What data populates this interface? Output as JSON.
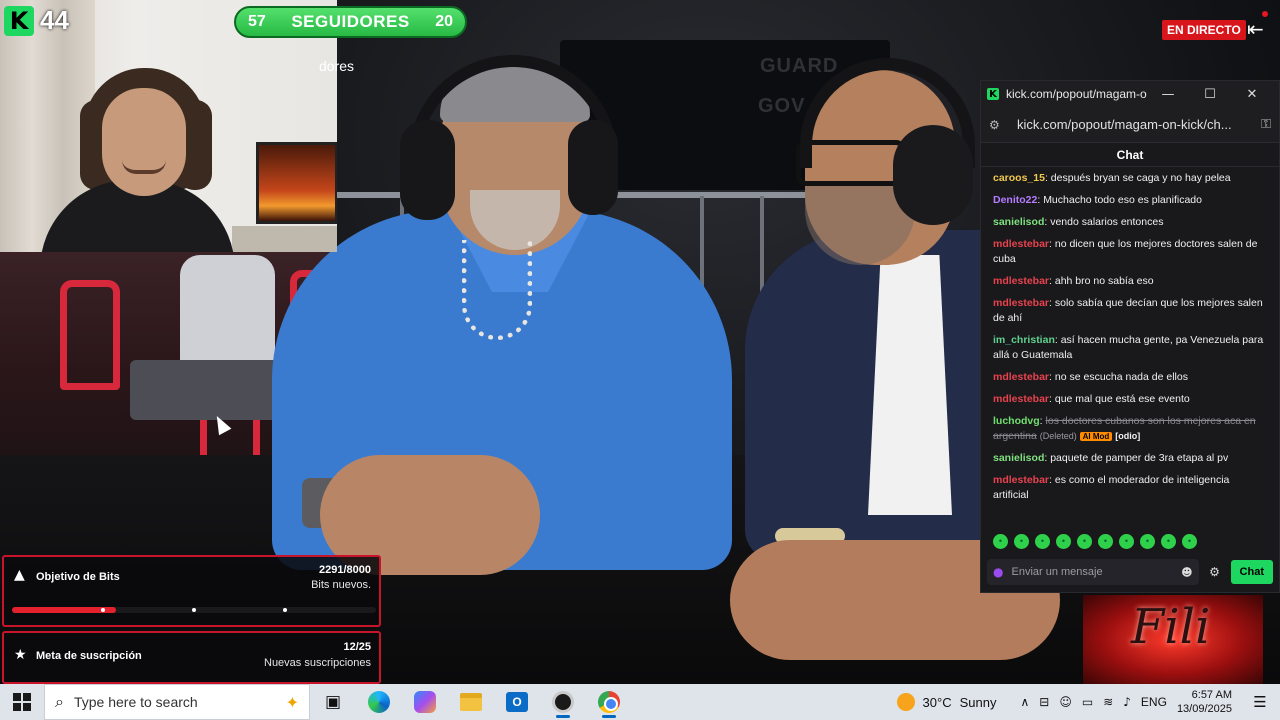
{
  "overlay": {
    "viewer_count": "44",
    "kick_icon_letter": "K",
    "followers_current": "57",
    "followers_label": "SEGUIDORES",
    "followers_goal": "20",
    "background_partial_text": "dores",
    "live_badge": "EN DIRECTO",
    "exit_icon": "exit-icon",
    "banner_text_1": "GUARD",
    "banner_text_2": "GOV",
    "bits_goal": {
      "title": "Objetivo de Bits",
      "value": "2291/8000",
      "subtitle": "Bits nuevos.",
      "progress": 0.286,
      "milestones": [
        0.25,
        0.5,
        0.75
      ]
    },
    "subs_goal": {
      "title": "Meta de suscripción",
      "value": "12/25",
      "subtitle": "Nuevas suscripciones"
    },
    "fili_text": "Fili"
  },
  "chat_window": {
    "title": "kick.com/popout/magam-o...",
    "url": "kick.com/popout/magam-on-kick/ch...",
    "header": "Chat",
    "messages": [
      {
        "user": "caroos_15",
        "color": "#f2c94c",
        "text": "después bryan se caga y no hay pelea"
      },
      {
        "user": "Denito22",
        "color": "#b57cff",
        "text": "Muchacho todo eso es planificado"
      },
      {
        "user": "sanielisod",
        "color": "#7ee07e",
        "text": "vendo salarios entonces"
      },
      {
        "user": "mdlestebar",
        "color": "#e8424e",
        "text": "no dicen que los mejores doctores salen de cuba"
      },
      {
        "user": "mdlestebar",
        "color": "#e8424e",
        "text": "ahh bro no sabía eso"
      },
      {
        "user": "mdlestebar",
        "color": "#e8424e",
        "text": "solo sabía que decían que los mejores salen de ahí"
      },
      {
        "user": "im_christian",
        "color": "#5fd38d",
        "text": "así hacen mucha gente, pa Venezuela para allá o Guatemala"
      },
      {
        "user": "mdlestebar",
        "color": "#e8424e",
        "text": "no se escucha nada de ellos"
      },
      {
        "user": "mdlestebar",
        "color": "#e8424e",
        "text": "que mal que está ese evento"
      },
      {
        "user": "luchodvg",
        "color": "#6fe06f",
        "text": "los doctores cubanos son los mejores aca en argentina",
        "deleted": true,
        "deleted_note": "(Deleted)",
        "badge": "AI Mod",
        "tag": "[odio]"
      },
      {
        "user": "sanielisod",
        "color": "#7ee07e",
        "text": "paquete de pamper de 3ra etapa al pv"
      },
      {
        "user": "mdlestebar",
        "color": "#e8424e",
        "text": "es como el moderador de inteligencia artificial"
      }
    ],
    "emotes": [
      "emote-1",
      "emote-2",
      "emote-3",
      "emote-4",
      "emote-5",
      "emote-6",
      "emote-7",
      "emote-8",
      "emote-9",
      "emote-10"
    ],
    "input_placeholder": "Enviar un mensaje",
    "send_label": "Chat"
  },
  "taskbar": {
    "search_placeholder": "Type here to search",
    "weather_temp": "30°C",
    "weather_cond": "Sunny",
    "lang": "ENG",
    "time": "6:57 AM",
    "date": "13/09/2025",
    "outlook_letter": "O"
  },
  "colors": {
    "kick_green": "#1ed760",
    "live_red": "#d9151c",
    "goal_border": "#c8142a"
  }
}
